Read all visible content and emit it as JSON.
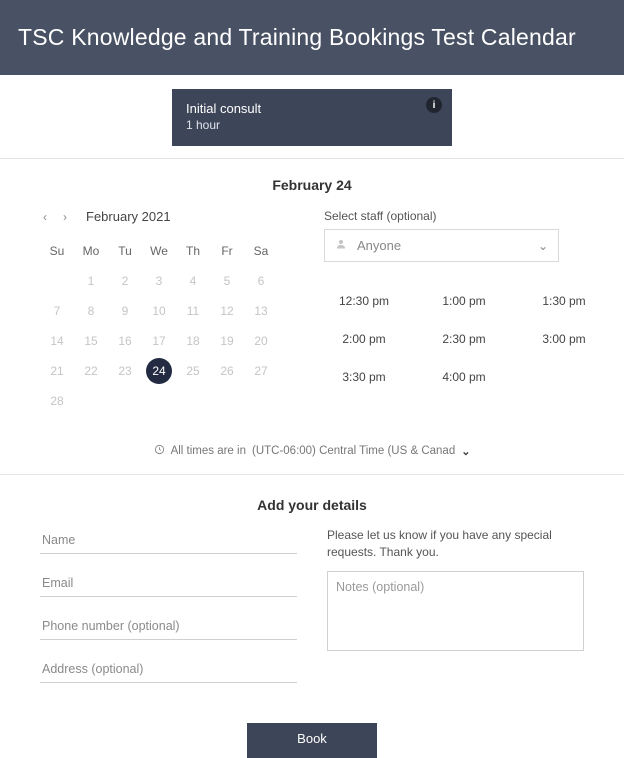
{
  "header": {
    "title": "TSC Knowledge and Training Bookings Test Calendar"
  },
  "service": {
    "name": "Initial consult",
    "duration": "1 hour",
    "info_icon": "i"
  },
  "selected_date_heading": "February 24",
  "calendar": {
    "prev_icon": "‹",
    "next_icon": "›",
    "month_label": "February 2021",
    "weekdays": [
      "Su",
      "Mo",
      "Tu",
      "We",
      "Th",
      "Fr",
      "Sa"
    ],
    "weeks": [
      [
        "",
        "1",
        "2",
        "3",
        "4",
        "5",
        "6"
      ],
      [
        "7",
        "8",
        "9",
        "10",
        "11",
        "12",
        "13"
      ],
      [
        "14",
        "15",
        "16",
        "17",
        "18",
        "19",
        "20"
      ],
      [
        "21",
        "22",
        "23",
        "24",
        "25",
        "26",
        "27"
      ],
      [
        "28",
        "",
        "",
        "",
        "",
        "",
        ""
      ]
    ],
    "selected_day": "24"
  },
  "staff": {
    "label": "Select staff (optional)",
    "value": "Anyone",
    "chevron": "⌄"
  },
  "slots": [
    "12:30 pm",
    "1:00 pm",
    "1:30 pm",
    "2:00 pm",
    "2:30 pm",
    "3:00 pm",
    "3:30 pm",
    "4:00 pm"
  ],
  "timezone": {
    "prefix": "All times are in",
    "value": "(UTC-06:00) Central Time (US & Canad",
    "chevron": "⌄"
  },
  "details": {
    "heading": "Add your details",
    "name_placeholder": "Name",
    "email_placeholder": "Email",
    "phone_placeholder": "Phone number (optional)",
    "address_placeholder": "Address (optional)",
    "special_requests_msg": "Please let us know if you have any special requests. Thank you.",
    "notes_placeholder": "Notes (optional)"
  },
  "footer": {
    "book_label": "Book"
  }
}
